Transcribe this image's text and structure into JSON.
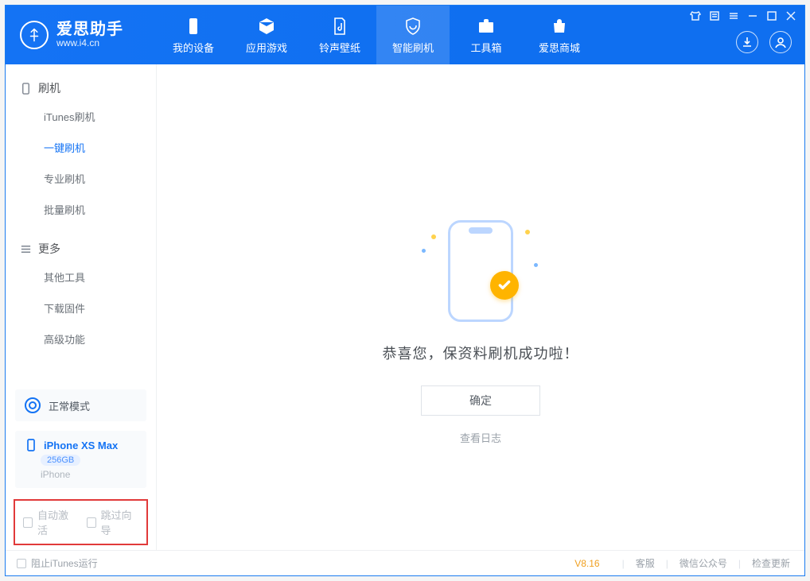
{
  "app": {
    "name": "爱思助手",
    "url": "www.i4.cn"
  },
  "nav": {
    "device": "我的设备",
    "apps": "应用游戏",
    "media": "铃声壁纸",
    "flash": "智能刷机",
    "tools": "工具箱",
    "store": "爱思商城"
  },
  "sidebar": {
    "section_flash": "刷机",
    "section_more": "更多",
    "flash_items": {
      "itunes": "iTunes刷机",
      "oneclick": "一键刷机",
      "pro": "专业刷机",
      "batch": "批量刷机"
    },
    "more_items": {
      "other": "其他工具",
      "firmware": "下载固件",
      "advanced": "高级功能"
    },
    "mode": "正常模式",
    "device_name": "iPhone XS Max",
    "device_capacity": "256GB",
    "device_type": "iPhone",
    "auto_activate": "自动激活",
    "skip_guide": "跳过向导"
  },
  "main": {
    "success": "恭喜您，保资料刷机成功啦！",
    "ok": "确定",
    "view_log": "查看日志"
  },
  "status": {
    "block_itunes": "阻止iTunes运行",
    "version": "V8.16",
    "support": "客服",
    "wechat": "微信公众号",
    "update": "检查更新"
  }
}
